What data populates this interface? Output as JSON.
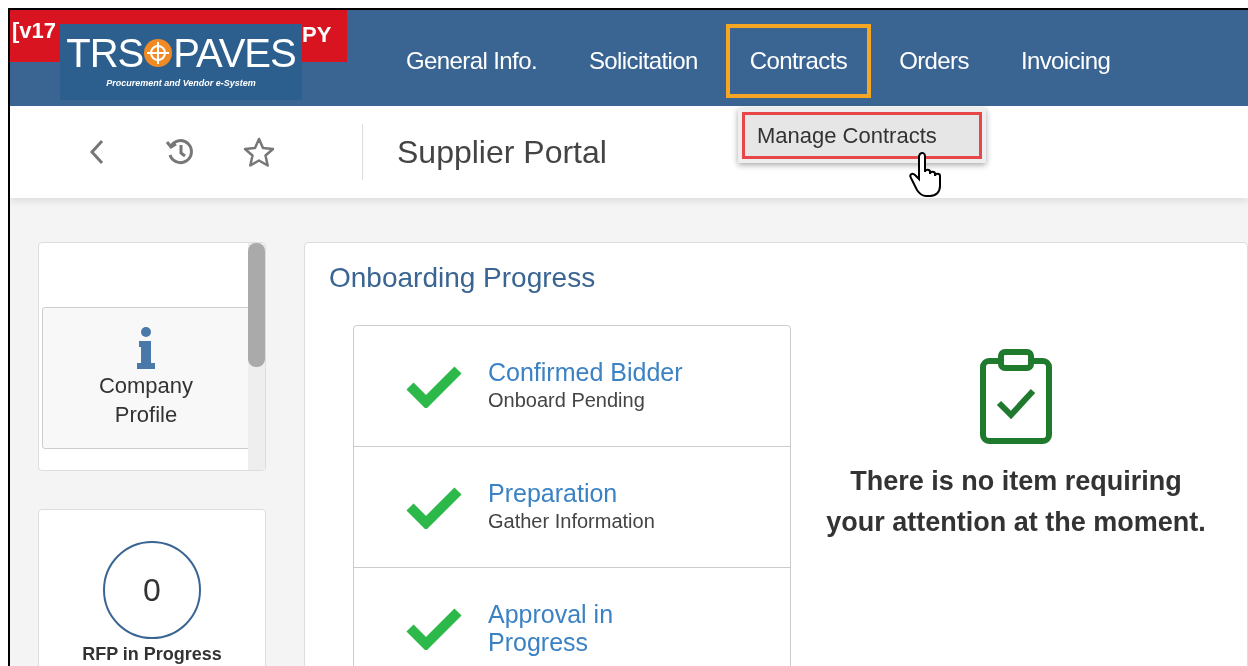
{
  "environment_banner": {
    "left_text": "[v17",
    "right_text": "PY"
  },
  "logo": {
    "left_word": "TRS",
    "right_word": "PAVES",
    "tagline": "Procurement and Vendor e-System"
  },
  "nav": [
    {
      "label": "General Info.",
      "selected": false
    },
    {
      "label": "Solicitation",
      "selected": false
    },
    {
      "label": "Contracts",
      "selected": true
    },
    {
      "label": "Orders",
      "selected": false
    },
    {
      "label": "Invoicing",
      "selected": false
    }
  ],
  "dropdown": {
    "items": [
      {
        "label": "Manage Contracts",
        "selected": true
      }
    ]
  },
  "toolbar": {
    "title": "Supplier Portal"
  },
  "sidebar": {
    "tiles": [
      {
        "kind": "icon",
        "label": "Company Profile"
      },
      {
        "kind": "count",
        "count": "0",
        "label": "RFP in Progress"
      }
    ]
  },
  "onboarding": {
    "title": "Onboarding Progress",
    "steps": [
      {
        "title": "Confirmed Bidder",
        "subtitle": "Onboard Pending",
        "done": true
      },
      {
        "title": "Preparation",
        "subtitle": "Gather Information",
        "done": true
      },
      {
        "title": "Approval in Progress",
        "done": true
      }
    ],
    "message": "There is no item requiring your attention at the moment."
  }
}
